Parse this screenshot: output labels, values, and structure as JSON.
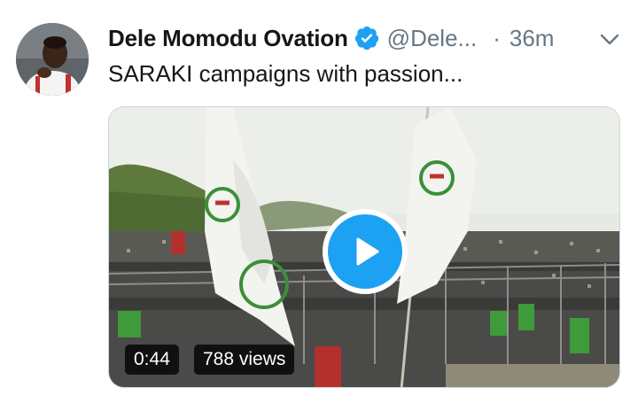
{
  "tweet": {
    "author": {
      "display_name": "Dele Momodu Ovation",
      "handle": "@Dele...",
      "verified": true
    },
    "separator": "·",
    "timestamp": "36m",
    "text": "SARAKI campaigns with passion...",
    "media": {
      "type": "video",
      "duration": "0:44",
      "views": "788 views"
    }
  },
  "icons": {
    "verified": "verified-badge-icon",
    "menu": "chevron-down-icon",
    "play": "play-icon"
  },
  "colors": {
    "accent": "#1da1f2",
    "text_primary": "#14171a",
    "text_secondary": "#657786"
  }
}
